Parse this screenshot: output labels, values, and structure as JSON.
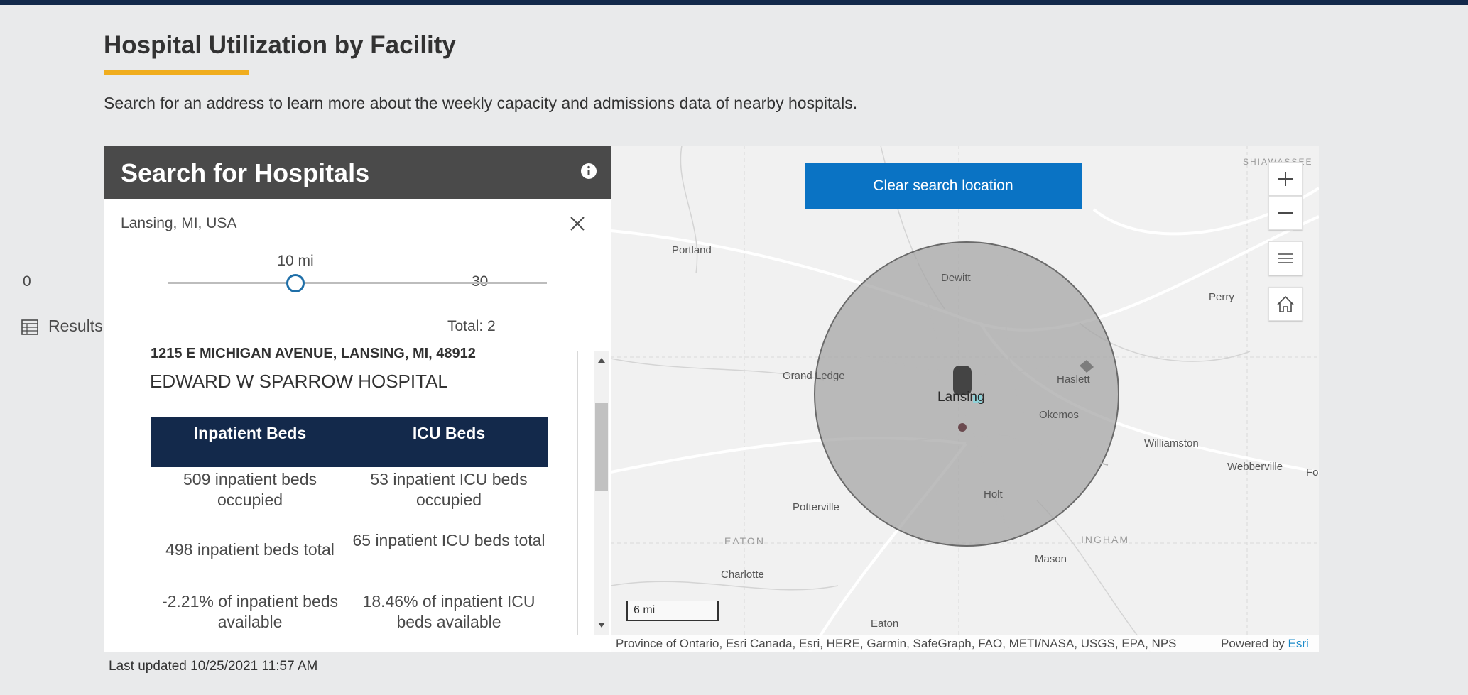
{
  "page": {
    "title": "Hospital Utilization by Facility",
    "subtitle": "Search for an address to learn more about the weekly capacity and admissions data of nearby hospitals.",
    "last_updated": "Last updated 10/25/2021 11:57 AM",
    "colors": {
      "topbar": "#13294b",
      "accent": "#f0ad1e",
      "button": "#0a73c4"
    }
  },
  "panel": {
    "title": "Search for Hospitals",
    "info_icon": "info-icon",
    "search": {
      "value": "Lansing, MI, USA",
      "clear_icon": "close-icon"
    },
    "slider": {
      "min": "0",
      "max": "30",
      "current_label": "10 mi",
      "value": 10
    },
    "results": {
      "icon": "table-icon",
      "label": "Results",
      "total": "Total: 2"
    }
  },
  "hospital": {
    "address": "1215 E MICHIGAN AVENUE, LANSING, MI, 48912",
    "name": "EDWARD W SPARROW HOSPITAL",
    "headers": [
      "Inpatient Beds",
      "ICU Beds"
    ],
    "rows": [
      [
        "509 inpatient beds occupied",
        "53 inpatient ICU beds occupied"
      ],
      [
        "498 inpatient beds total",
        "65 inpatient ICU beds total"
      ],
      [
        "-2.21% of inpatient beds available",
        "18.46% of inpatient ICU beds available"
      ]
    ]
  },
  "map": {
    "clear_button": "Clear search location",
    "places": {
      "portland": "Portland",
      "dewitt": "Dewitt",
      "perry": "Perry",
      "grand_ledge": "Grand Ledge",
      "lansing": "Lansing",
      "haslett": "Haslett",
      "okemos": "Okemos",
      "williamston": "Williamston",
      "webberville": "Webberville",
      "fo": "Fo",
      "holt": "Holt",
      "potterville": "Potterville",
      "charlotte": "Charlotte",
      "mason": "Mason",
      "eaton_town": "Eaton"
    },
    "regions": {
      "shiawassee": "SHIAWASSEE",
      "eaton": "EATON",
      "ingham": "INGHAM"
    },
    "controls": [
      "zoom-in-icon",
      "zoom-out-icon",
      "list-icon",
      "home-icon"
    ],
    "scale": "6 mi",
    "attribution": "Province of Ontario, Esri Canada, Esri, HERE, Garmin, SafeGraph, FAO, METI/NASA, USGS, EPA, NPS",
    "powered_by": "Powered by",
    "esri": "Esri"
  }
}
